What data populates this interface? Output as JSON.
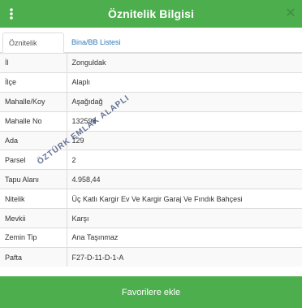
{
  "header": {
    "title": "Öznitelik Bilgisi",
    "menu_icon": "vertical-ellipsis-icon",
    "close_icon": "close-icon"
  },
  "tabs": [
    {
      "label": "Öznitelik Bilgisi",
      "active": true
    },
    {
      "label": "Bina/BB Listesi",
      "active": false
    }
  ],
  "attributes": [
    {
      "key": "İl",
      "value": "Zonguldak"
    },
    {
      "key": "İlçe",
      "value": "Alaplı"
    },
    {
      "key": "Mahalle/Koy",
      "value": "Aşağıdağ"
    },
    {
      "key": "Mahalle No",
      "value": "132598"
    },
    {
      "key": "Ada",
      "value": "129"
    },
    {
      "key": "Parsel",
      "value": "2"
    },
    {
      "key": "Tapu Alanı",
      "value": "4.958,44"
    },
    {
      "key": "Nitelik",
      "value": "Üç Katlı Kargir Ev Ve Kargir Garaj Ve Fındık Bahçesi"
    },
    {
      "key": "Mevkii",
      "value": "Karşı"
    },
    {
      "key": "Zemin Tip",
      "value": "Ana Taşınmaz"
    },
    {
      "key": "Pafta",
      "value": "F27-D-11-D-1-A"
    }
  ],
  "watermark": "ÖZTÜRK EMLAK ALAPLI",
  "footer": {
    "favorite_label": "Favorilere ekle"
  },
  "colors": {
    "accent": "#4cae4c",
    "link": "#337ab7",
    "close_icon": "#3e8e3e"
  }
}
